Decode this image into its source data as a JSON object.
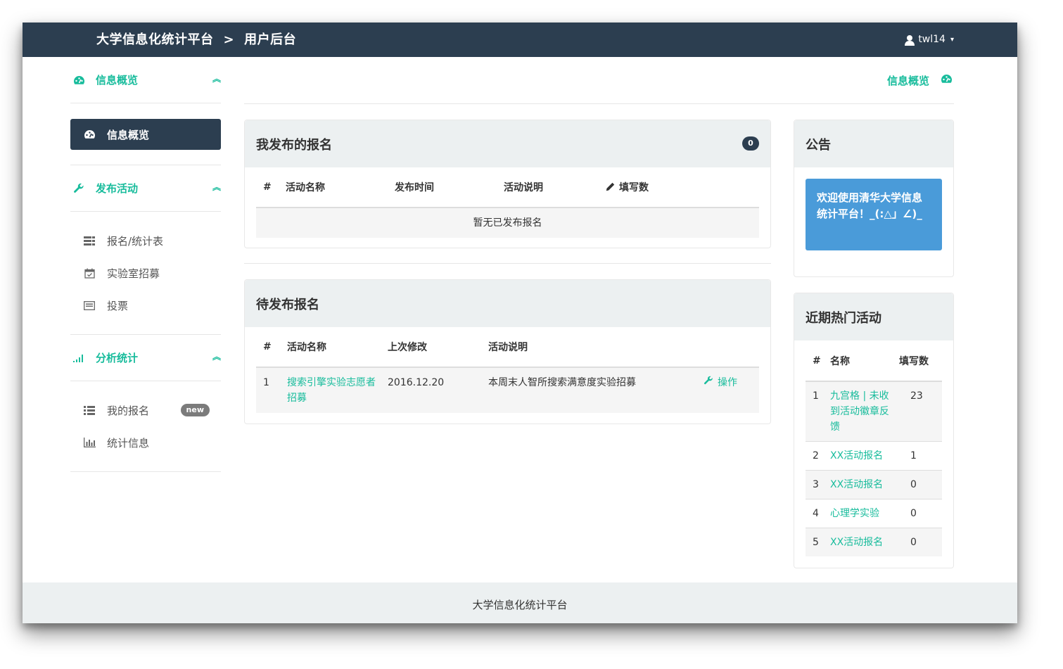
{
  "navbar": {
    "brand": "大学信息化统计平台",
    "separator": ">",
    "section": "用户后台",
    "username": "twl14"
  },
  "sidebar": {
    "overview_header": "信息概览",
    "overview_active": "信息概览",
    "publish_header": "发布活动",
    "publish_items": [
      {
        "label": "报名/统计表",
        "icon": "table-list-icon"
      },
      {
        "label": "实验室招募",
        "icon": "calendar-check-icon"
      },
      {
        "label": "投票",
        "icon": "ballot-card-icon"
      }
    ],
    "analysis_header": "分析统计",
    "analysis_items": [
      {
        "label": "我的报名",
        "icon": "list-icon",
        "badge": "new"
      },
      {
        "label": "统计信息",
        "icon": "bar-chart-icon"
      }
    ]
  },
  "breadcrumb_right": "信息概览",
  "published_panel": {
    "title": "我发布的报名",
    "count": "0",
    "columns": [
      "#",
      "活动名称",
      "发布时间",
      "活动说明",
      "填写数"
    ],
    "empty_text": "暂无已发布报名"
  },
  "pending_panel": {
    "title": "待发布报名",
    "columns": [
      "#",
      "活动名称",
      "上次修改",
      "活动说明"
    ],
    "rows": [
      {
        "index": "1",
        "name": "搜索引擎实验志愿者招募",
        "modified": "2016.12.20",
        "desc": "本周末人智所搜索满意度实验招募",
        "action": "操作"
      }
    ]
  },
  "notice_panel": {
    "title": "公告",
    "message": "欢迎使用清华大学信息统计平台！_(:△」∠)_"
  },
  "hot_panel": {
    "title": "近期热门活动",
    "columns": [
      "#",
      "名称",
      "填写数"
    ],
    "rows": [
      {
        "index": "1",
        "name": "九宫格 | 未收到活动徽章反馈",
        "count": "23"
      },
      {
        "index": "2",
        "name": "XX活动报名",
        "count": "1"
      },
      {
        "index": "3",
        "name": "XX活动报名",
        "count": "0"
      },
      {
        "index": "4",
        "name": "心理学实验",
        "count": "0"
      },
      {
        "index": "5",
        "name": "XX活动报名",
        "count": "0"
      }
    ]
  },
  "footer": {
    "text": "大学信息化统计平台"
  },
  "colors": {
    "navbar": "#2c3e50",
    "accent": "#18bc9c",
    "panel_header": "#ecf0f1",
    "notice": "#4a9bd9"
  }
}
